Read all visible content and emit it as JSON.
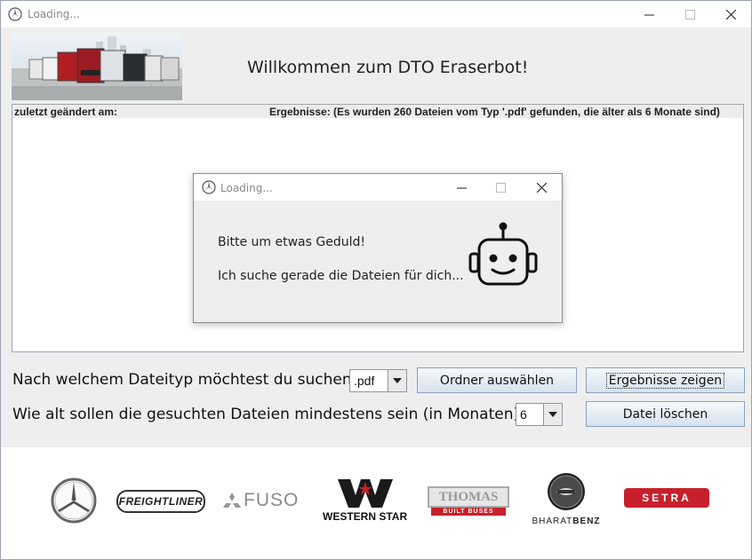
{
  "window": {
    "title": "Loading..."
  },
  "header": {
    "welcome": "Willkommen zum DTO Eraserbot!"
  },
  "results": {
    "col_modified": "zuletzt geändert am:",
    "col_results": "Ergebnisse:  (Es wurden 260 Dateien vom Typ '.pdf' gefunden, die älter als 6 Monate sind)"
  },
  "controls": {
    "filetype_question": "Nach welchem Dateityp möchtest du suchen?",
    "filetype_value": ".pdf",
    "age_question": "Wie alt sollen die gesuchten Dateien mindestens sein (in Monaten)?",
    "age_value": "6",
    "choose_folder": "Ordner auswählen",
    "show_results": "Ergebnisse zeigen",
    "delete_file": "Datei löschen"
  },
  "dialog": {
    "title": "Loading...",
    "line1": "Bitte um etwas Geduld!",
    "line2": "Ich suche gerade die Dateien für dich..."
  },
  "brands": {
    "freightliner": "FREIGHTLINER",
    "fuso": "FUSO",
    "western_star": "WESTERN STAR",
    "thomas": "THOMAS",
    "thomas_sub": "BUILT BUSES",
    "bharat": "BHARAT",
    "benz": "BENZ",
    "setra": "SETRA"
  },
  "colors": {
    "setra_red": "#c8202a",
    "thomas_red": "#c8202a",
    "button_border": "#8aa2bd"
  }
}
